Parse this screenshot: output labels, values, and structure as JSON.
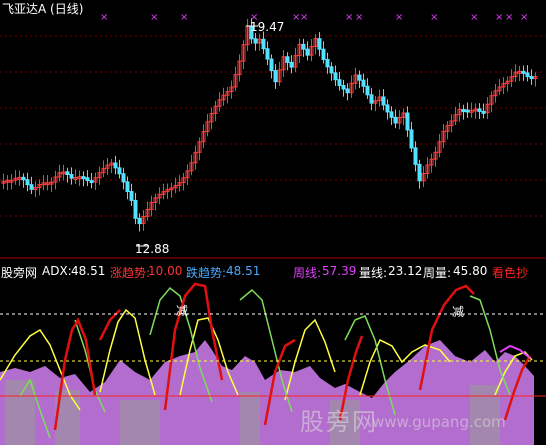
{
  "upper_panel": {
    "title": "飞亚达A (日线)",
    "high_label": "19.47",
    "low_label": "12.88",
    "cross_marker": "×"
  },
  "indicator_panel": {
    "name": "股旁网",
    "adx_label": "ADX:",
    "adx_value": "48.51",
    "up_label": "涨趋势:",
    "up_value": "10.00",
    "down_label": "跌趋势:",
    "down_value": "48.51",
    "weekly_label": "周线:",
    "weekly_value": "57.39",
    "volume_label": "量线:",
    "volume_value": "23.12",
    "weekvol_label": "周量:",
    "weekvol_value": "45.80",
    "bullish_label": "看色抄",
    "reduce_tag": "减"
  },
  "watermark": {
    "cn": "股旁网",
    "url": "www.gupang.com"
  },
  "colors": {
    "background": "#000000",
    "candle_up": "#ff3b3b",
    "candle_down": "#54e0ff",
    "adx": "#ffffff",
    "up_trend": "#ff3333",
    "down_trend": "#4aa8ff",
    "weekly": "#e040fb",
    "volume": "#ffffff",
    "weekvol": "#ffffff",
    "bullish": "#ff2020",
    "area": "#c779e6",
    "line_yellow": "#ffff40",
    "line_green": "#7ddc5a",
    "line_red": "#e01010"
  }
}
